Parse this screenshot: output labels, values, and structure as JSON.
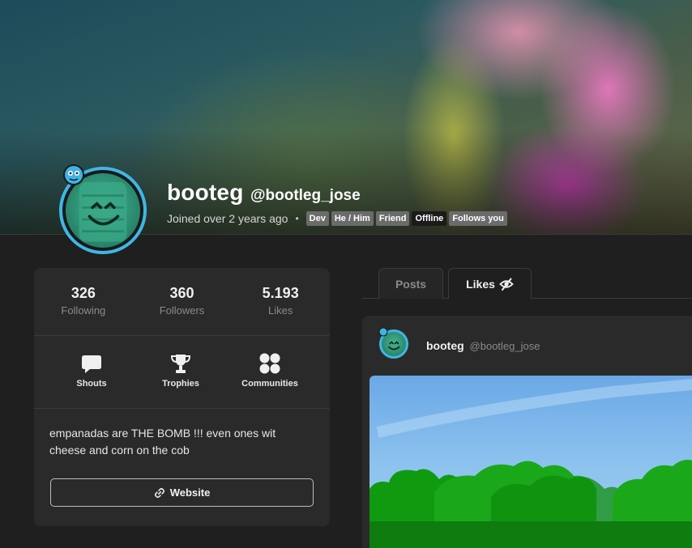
{
  "profile": {
    "display_name": "booteg",
    "handle": "@bootleg_jose",
    "joined": "Joined over 2 years ago",
    "separator": "•",
    "tags": [
      "Dev",
      "He / Him",
      "Friend",
      "Offline",
      "Follows you"
    ]
  },
  "stats": [
    {
      "value": "326",
      "label": "Following"
    },
    {
      "value": "360",
      "label": "Followers"
    },
    {
      "value": "5.193",
      "label": "Likes"
    }
  ],
  "actions": [
    {
      "label": "Shouts",
      "icon": "speech-bubble-icon"
    },
    {
      "label": "Trophies",
      "icon": "trophy-icon"
    },
    {
      "label": "Communities",
      "icon": "communities-icon"
    }
  ],
  "bio": "empanadas are THE BOMB !!! even ones wit cheese and corn on the cob",
  "website_label": "Website",
  "tabs": [
    {
      "label": "Posts",
      "active": false
    },
    {
      "label": "Likes",
      "active": true,
      "icon": "eye-slash-icon"
    }
  ],
  "post": {
    "author_name": "booteg",
    "author_handle": "@bootleg_jose"
  },
  "colors": {
    "accent": "#40b6e6",
    "background": "#1f1f1f",
    "card": "#2a2a2a",
    "tag": "#6b6b6b",
    "tag_dark": "#1b1b1b"
  }
}
